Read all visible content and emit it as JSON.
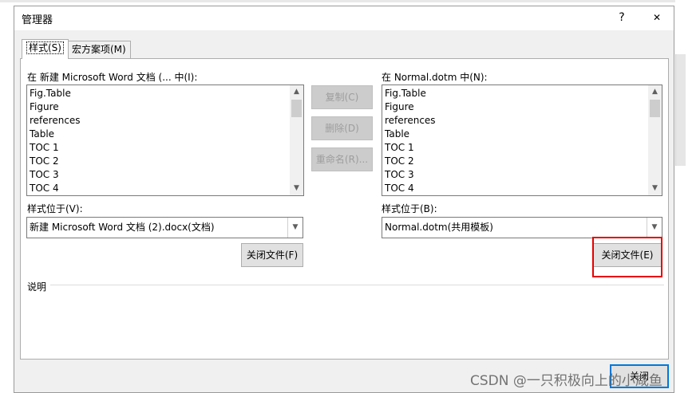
{
  "dialog": {
    "title": "管理器",
    "help": "?",
    "close": "✕"
  },
  "tabs": [
    {
      "label": "样式(S)",
      "active": true
    },
    {
      "label": "宏方案项(M)",
      "active": false
    }
  ],
  "left": {
    "heading": "在 新建 Microsoft Word 文档 (... 中(I):",
    "items": [
      "Fig.Table",
      "Figure",
      "references",
      "Table",
      "TOC 1",
      "TOC 2",
      "TOC 3",
      "TOC 4"
    ],
    "location_label": "样式位于(V):",
    "location_value": "新建 Microsoft Word 文档 (2).docx(文档)",
    "close_file": "关闭文件(F)"
  },
  "right": {
    "heading": "在 Normal.dotm 中(N):",
    "items": [
      "Fig.Table",
      "Figure",
      "references",
      "Table",
      "TOC 1",
      "TOC 2",
      "TOC 3",
      "TOC 4"
    ],
    "location_label": "样式位于(B):",
    "location_value": "Normal.dotm(共用模板)",
    "close_file": "关闭文件(E)"
  },
  "actions": {
    "copy": "复制(C)",
    "delete": "删除(D)",
    "rename": "重命名(R)..."
  },
  "description_label": "说明",
  "ok_label": "关闭",
  "watermark": "CSDN @一只积极向上的小咸鱼",
  "colors": {
    "highlight": "#e60000",
    "focus": "#0078d7"
  }
}
